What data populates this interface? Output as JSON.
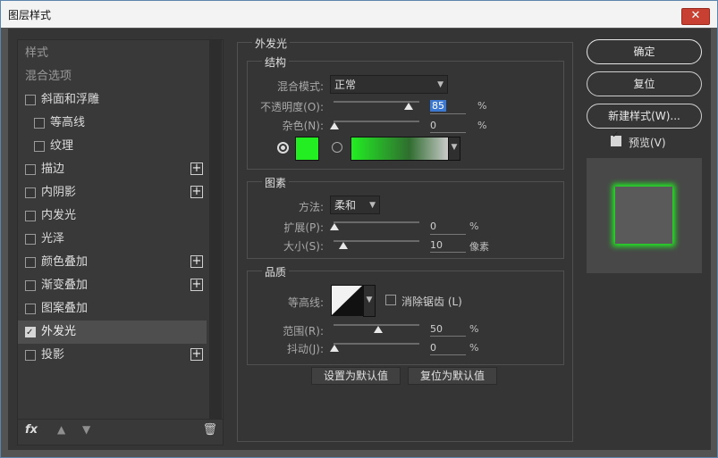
{
  "window": {
    "title": "图层样式",
    "close": "✕"
  },
  "sidebar": {
    "items": [
      {
        "label": "样式"
      },
      {
        "label": "混合选项"
      },
      {
        "label": "斜面和浮雕"
      },
      {
        "label": "等高线"
      },
      {
        "label": "纹理"
      },
      {
        "label": "描边"
      },
      {
        "label": "内阴影"
      },
      {
        "label": "内发光"
      },
      {
        "label": "光泽"
      },
      {
        "label": "颜色叠加"
      },
      {
        "label": "渐变叠加"
      },
      {
        "label": "图案叠加"
      },
      {
        "label": "外发光"
      },
      {
        "label": "投影"
      }
    ],
    "footer": {
      "fx": "fx",
      "up": "▲",
      "down": "▼",
      "trash": "🗑"
    }
  },
  "panel": {
    "title": "外发光",
    "structure": {
      "title": "结构",
      "blend_label": "混合模式:",
      "blend_value": "正常",
      "opacity_label": "不透明度(O):",
      "opacity_value": "85",
      "noise_label": "杂色(N):",
      "noise_value": "0",
      "percent": "%",
      "glow_color": "#22ee22"
    },
    "elements": {
      "title": "图素",
      "method_label": "方法:",
      "method_value": "柔和",
      "spread_label": "扩展(P):",
      "spread_value": "0",
      "size_label": "大小(S):",
      "size_value": "10",
      "size_unit": "像素",
      "percent": "%"
    },
    "quality": {
      "title": "品质",
      "contour_label": "等高线:",
      "antialias_label": "消除锯齿 (L)",
      "range_label": "范围(R):",
      "range_value": "50",
      "jitter_label": "抖动(J):",
      "jitter_value": "0",
      "percent": "%"
    },
    "make_default": "设置为默认值",
    "reset_default": "复位为默认值"
  },
  "right": {
    "ok": "确定",
    "reset": "复位",
    "new_style": "新建样式(W)...",
    "preview_label": "预览(V)"
  },
  "chevron": "⌄"
}
